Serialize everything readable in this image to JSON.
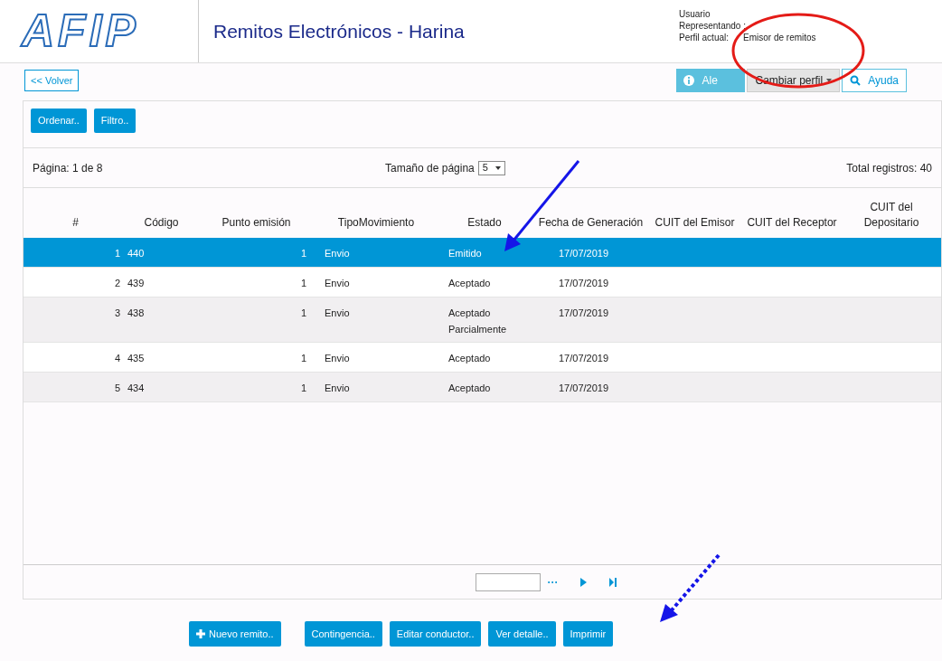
{
  "header": {
    "logo": "AFIP",
    "title": "Remitos Electrónicos - Harina",
    "user_labels": [
      "Usuario",
      "Representando :",
      "Perfil actual:"
    ],
    "profile": "Emisor de remitos"
  },
  "toolbar": {
    "back": "<< Volver",
    "alerts": "Ale",
    "change_profile": "Cambiar perfil",
    "help": "Ayuda"
  },
  "actions": [
    "Ordenar..",
    "Filtro.."
  ],
  "paging": {
    "page": "Página:  1 de 8",
    "page_size_label": "Tamaño de página",
    "page_size": "5",
    "total": "Total registros:  40"
  },
  "table": {
    "columns": [
      "#",
      "Código",
      "Punto emisión",
      "TipoMovimiento",
      "Estado",
      "Fecha de Generación",
      "CUIT del Emisor",
      "CUIT del Receptor",
      "CUIT del Depositario"
    ],
    "rows": [
      {
        "selected": true,
        "cells": [
          "1",
          "440",
          "1",
          "Envio",
          "Emitido",
          "17/07/2019"
        ]
      },
      {
        "selected": false,
        "cells": [
          "2",
          "439",
          "1",
          "Envio",
          "Aceptado",
          "17/07/2019"
        ]
      },
      {
        "selected": false,
        "cells": [
          "3",
          "438",
          "1",
          "Envio",
          "Aceptado Parcialmente",
          "17/07/2019"
        ]
      },
      {
        "selected": false,
        "cells": [
          "4",
          "435",
          "1",
          "Envio",
          "Aceptado",
          "17/07/2019"
        ]
      },
      {
        "selected": false,
        "cells": [
          "5",
          "434",
          "1",
          "Envio",
          "Aceptado",
          "17/07/2019"
        ]
      }
    ]
  },
  "pager": {
    "more": "···"
  },
  "buttons": [
    {
      "label": "Nuevo remito..",
      "kind": "add"
    },
    {
      "label": "Contingencia..",
      "kind": "plain"
    },
    {
      "label": "Editar conductor..",
      "kind": "plain"
    },
    {
      "label": "Ver detalle..",
      "kind": "plain"
    },
    {
      "label": "Imprimir",
      "kind": "plain"
    }
  ]
}
